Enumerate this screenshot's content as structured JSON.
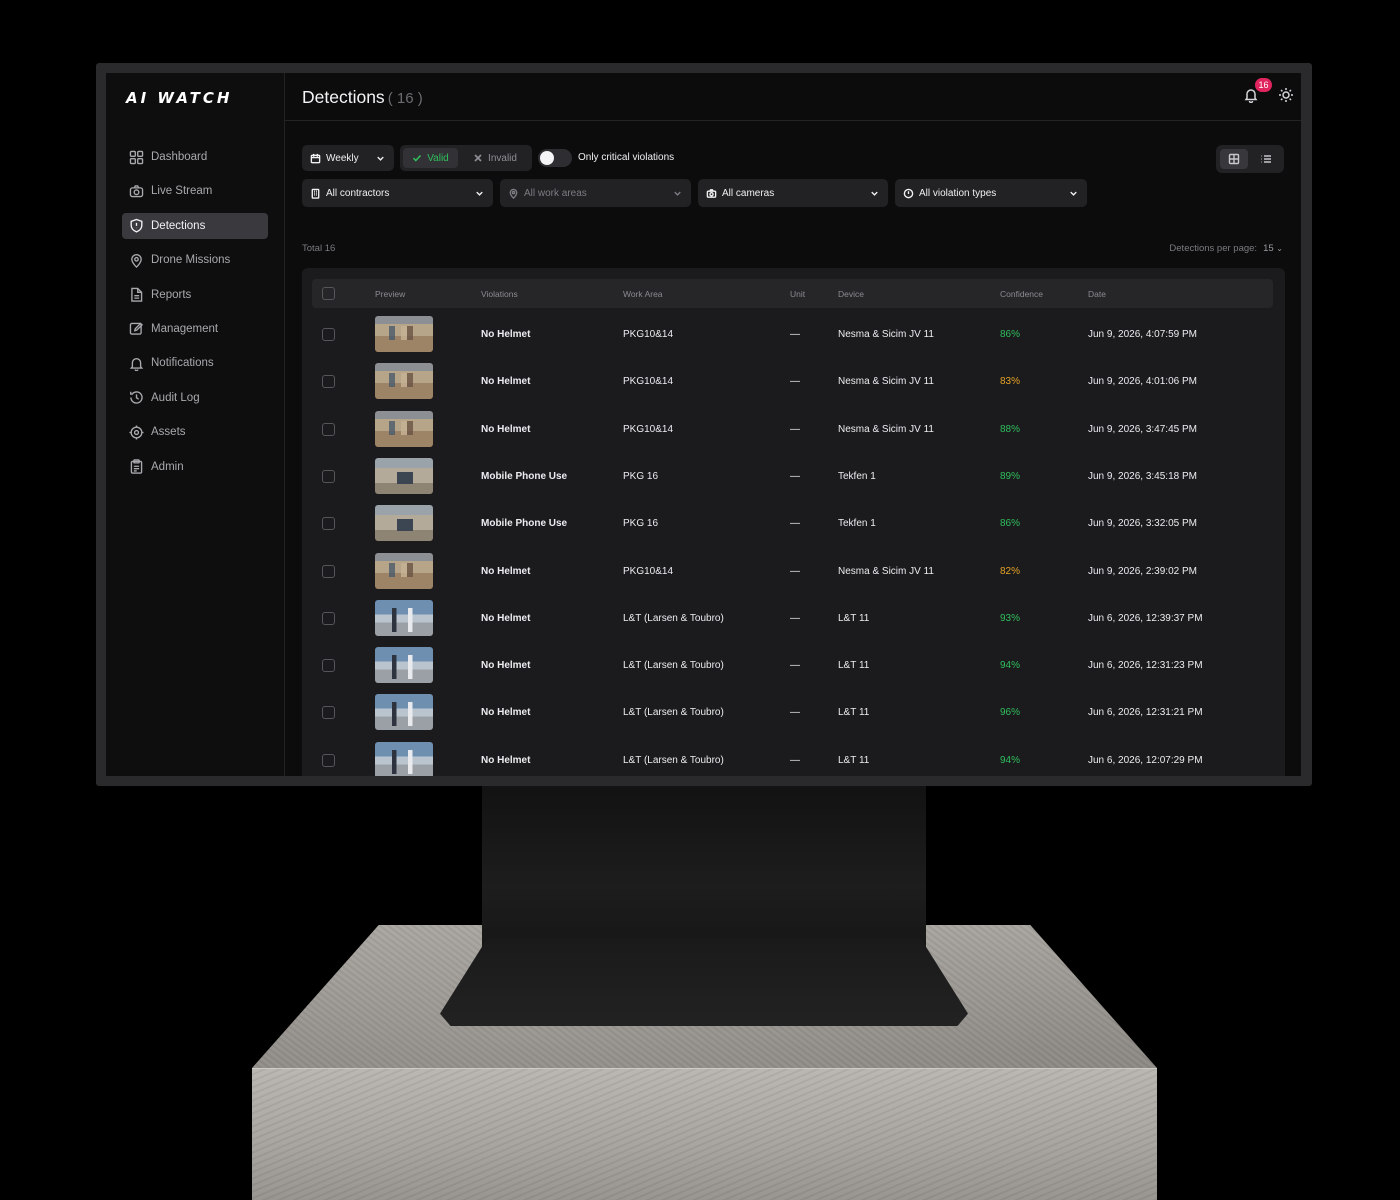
{
  "brand": {
    "logo_text": "AI WATCH"
  },
  "sidebar": {
    "items": [
      {
        "label": "Dashboard",
        "icon": "grid-icon",
        "active": false
      },
      {
        "label": "Live Stream",
        "icon": "camera-icon",
        "active": false
      },
      {
        "label": "Detections",
        "icon": "shield-alert-icon",
        "active": true
      },
      {
        "label": "Drone Missions",
        "icon": "map-pin-icon",
        "active": false
      },
      {
        "label": "Reports",
        "icon": "file-icon",
        "active": false
      },
      {
        "label": "Management",
        "icon": "edit-icon",
        "active": false
      },
      {
        "label": "Notifications",
        "icon": "bell-icon",
        "active": false
      },
      {
        "label": "Audit Log",
        "icon": "history-icon",
        "active": false
      },
      {
        "label": "Assets",
        "icon": "target-icon",
        "active": false
      },
      {
        "label": "Admin",
        "icon": "clipboard-icon",
        "active": false
      }
    ]
  },
  "header": {
    "title": "Detections",
    "count": "( 16 )",
    "notification_count": "16"
  },
  "filters": {
    "period": "Weekly",
    "valid_label": "Valid",
    "invalid_label": "Invalid",
    "critical_toggle_label": "Only critical violations",
    "critical_toggle_on": false,
    "contractors": "All contractors",
    "work_areas": "All work areas",
    "cameras": "All cameras",
    "violation_types": "All violation types",
    "view_mode": "grid"
  },
  "summary": {
    "total_label": "Total 16",
    "per_page_label": "Detections per page:",
    "per_page_value": "15"
  },
  "table": {
    "columns": [
      "Preview",
      "Violations",
      "Work Area",
      "Unit",
      "Device",
      "Confidence",
      "Date"
    ],
    "rows": [
      {
        "preview": "site",
        "violation": "No Helmet",
        "work_area": "PKG10&14",
        "unit": "—",
        "device": "Nesma & Sicim JV 11",
        "confidence": "86%",
        "level": "high",
        "date": "Jun 9, 2026, 4:07:59 PM"
      },
      {
        "preview": "site",
        "violation": "No Helmet",
        "work_area": "PKG10&14",
        "unit": "—",
        "device": "Nesma & Sicim JV 11",
        "confidence": "83%",
        "level": "medium",
        "date": "Jun 9, 2026, 4:01:06 PM"
      },
      {
        "preview": "site",
        "violation": "No Helmet",
        "work_area": "PKG10&14",
        "unit": "—",
        "device": "Nesma & Sicim JV 11",
        "confidence": "88%",
        "level": "high",
        "date": "Jun 9, 2026, 3:47:45 PM"
      },
      {
        "preview": "beach",
        "violation": "Mobile Phone Use",
        "work_area": "PKG 16",
        "unit": "—",
        "device": "Tekfen 1",
        "confidence": "89%",
        "level": "high",
        "date": "Jun 9, 2026, 3:45:18 PM"
      },
      {
        "preview": "beach",
        "violation": "Mobile Phone Use",
        "work_area": "PKG 16",
        "unit": "—",
        "device": "Tekfen 1",
        "confidence": "86%",
        "level": "high",
        "date": "Jun 9, 2026, 3:32:05 PM"
      },
      {
        "preview": "site",
        "violation": "No Helmet",
        "work_area": "PKG10&14",
        "unit": "—",
        "device": "Nesma & Sicim JV 11",
        "confidence": "82%",
        "level": "medium",
        "date": "Jun 9, 2026, 2:39:02 PM"
      },
      {
        "preview": "indoor",
        "violation": "No Helmet",
        "work_area": "L&T (Larsen & Toubro)",
        "unit": "—",
        "device": "L&T 11",
        "confidence": "93%",
        "level": "high",
        "date": "Jun 6, 2026, 12:39:37 PM"
      },
      {
        "preview": "indoor",
        "violation": "No Helmet",
        "work_area": "L&T (Larsen & Toubro)",
        "unit": "—",
        "device": "L&T 11",
        "confidence": "94%",
        "level": "high",
        "date": "Jun 6, 2026, 12:31:23 PM"
      },
      {
        "preview": "indoor",
        "violation": "No Helmet",
        "work_area": "L&T (Larsen & Toubro)",
        "unit": "—",
        "device": "L&T 11",
        "confidence": "96%",
        "level": "high",
        "date": "Jun 6, 2026, 12:31:21 PM"
      },
      {
        "preview": "indoor",
        "violation": "No Helmet",
        "work_area": "L&T (Larsen & Toubro)",
        "unit": "—",
        "device": "L&T 11",
        "confidence": "94%",
        "level": "high",
        "date": "Jun 6, 2026, 12:07:29 PM"
      }
    ]
  },
  "colors": {
    "confidence_high": "#2fbf5b",
    "confidence_medium": "#e5a224",
    "badge": "#e0245e",
    "valid_accent": "#2fbf5b"
  }
}
